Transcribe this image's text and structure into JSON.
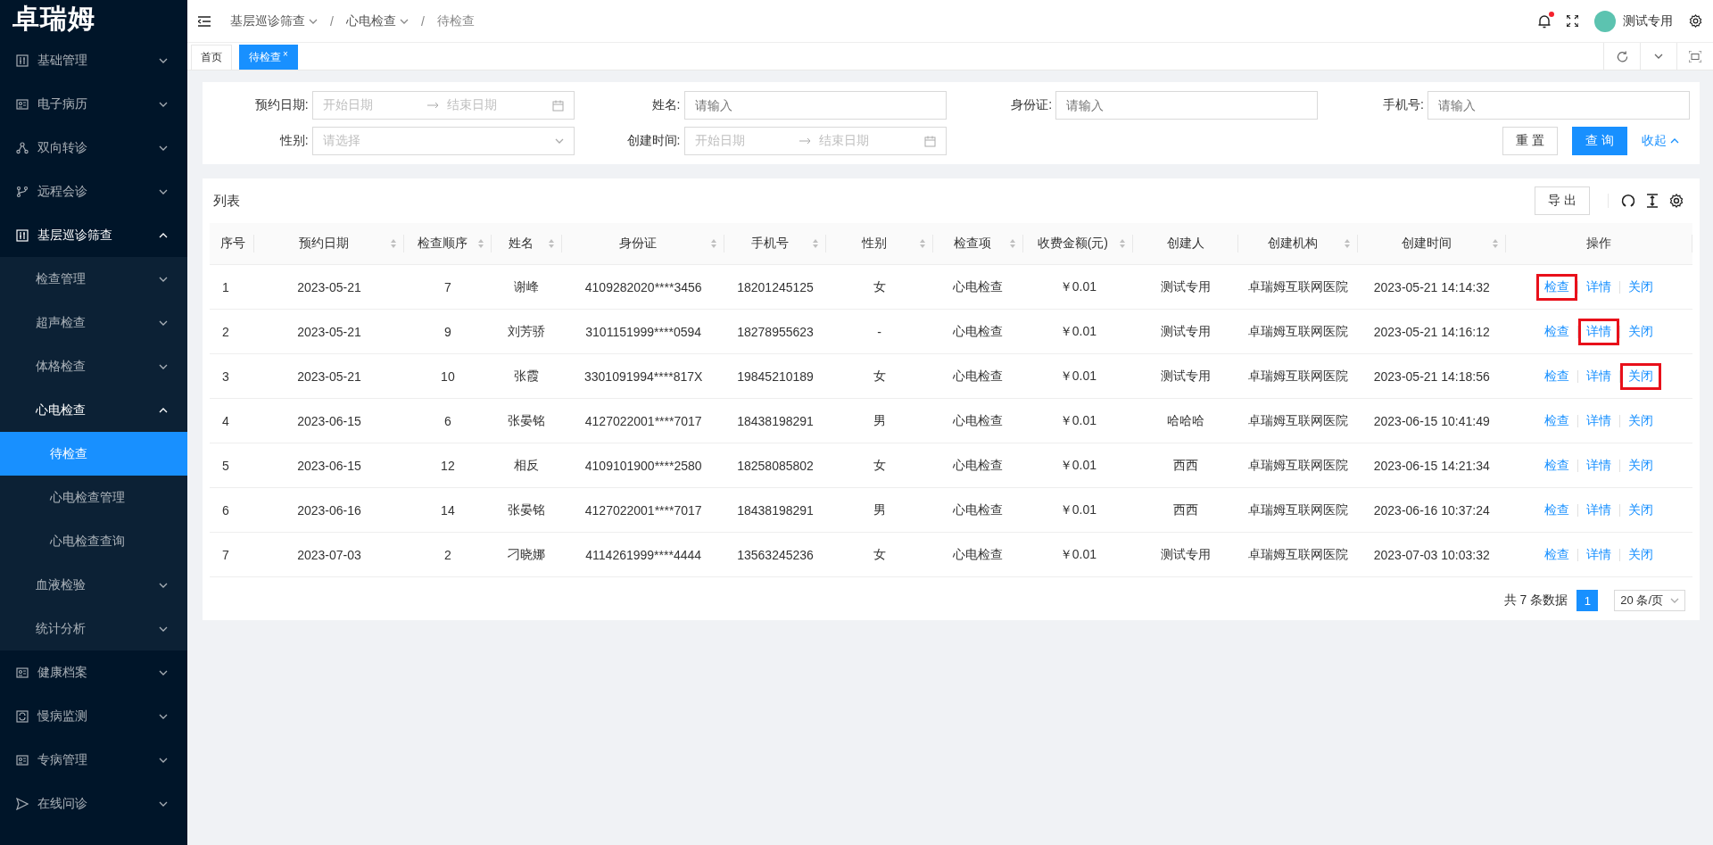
{
  "sidebar": {
    "logo": "卓瑞姆",
    "items": [
      {
        "label": "基础管理",
        "expanded": false
      },
      {
        "label": "电子病历",
        "expanded": false
      },
      {
        "label": "双向转诊",
        "expanded": false
      },
      {
        "label": "远程会诊",
        "expanded": false
      },
      {
        "label": "基层巡诊筛查",
        "expanded": true,
        "children": [
          {
            "label": "检查管理",
            "expanded": false
          },
          {
            "label": "超声检查",
            "expanded": false
          },
          {
            "label": "体格检查",
            "expanded": false
          },
          {
            "label": "心电检查",
            "expanded": true,
            "children": [
              {
                "label": "待检查",
                "selected": true
              },
              {
                "label": "心电检查管理",
                "selected": false
              },
              {
                "label": "心电检查查询",
                "selected": false
              }
            ]
          },
          {
            "label": "血液检验",
            "expanded": false
          },
          {
            "label": "统计分析",
            "expanded": false
          }
        ]
      },
      {
        "label": "健康档案",
        "expanded": false
      },
      {
        "label": "慢病监测",
        "expanded": false
      },
      {
        "label": "专病管理",
        "expanded": false
      },
      {
        "label": "在线问诊",
        "expanded": false
      }
    ]
  },
  "header": {
    "separator": "/",
    "breadcrumb": [
      {
        "label": "基层巡诊筛查",
        "dropdown": true
      },
      {
        "label": "心电检查",
        "dropdown": true
      },
      {
        "label": "待检查",
        "dropdown": false
      }
    ],
    "notification_dot": true,
    "user": "测试专用"
  },
  "tabs": [
    {
      "label": "首页",
      "selected": false
    },
    {
      "label": "待检查",
      "selected": true,
      "close": "×"
    }
  ],
  "filters": {
    "fields": [
      {
        "label": "预约日期:",
        "kind": "date-range",
        "start_placeholder": "开始日期",
        "end_placeholder": "结束日期"
      },
      {
        "label": "姓名:",
        "kind": "input",
        "placeholder": "请输入"
      },
      {
        "label": "身份证:",
        "kind": "input",
        "placeholder": "请输入"
      },
      {
        "label": "手机号:",
        "kind": "input",
        "placeholder": "请输入"
      },
      {
        "label": "性别:",
        "kind": "select",
        "placeholder": "请选择"
      },
      {
        "label": "创建时间:",
        "kind": "date-range",
        "start_placeholder": "开始日期",
        "end_placeholder": "结束日期"
      }
    ],
    "reset": "重 置",
    "query": "查 询",
    "collapse": "收起"
  },
  "table": {
    "title": "列表",
    "export": "导 出",
    "columns": [
      {
        "label": "序号",
        "sortable": false
      },
      {
        "label": "预约日期",
        "sortable": true
      },
      {
        "label": "检查顺序",
        "sortable": true
      },
      {
        "label": "姓名",
        "sortable": true
      },
      {
        "label": "身份证",
        "sortable": true
      },
      {
        "label": "手机号",
        "sortable": true
      },
      {
        "label": "性别",
        "sortable": true
      },
      {
        "label": "检查项",
        "sortable": true
      },
      {
        "label": "收费金额(元)",
        "sortable": true
      },
      {
        "label": "创建人",
        "sortable": false
      },
      {
        "label": "创建机构",
        "sortable": true
      },
      {
        "label": "创建时间",
        "sortable": true
      },
      {
        "label": "操作",
        "sortable": false
      }
    ],
    "rows": [
      {
        "cells": [
          "1",
          "2023-05-21",
          "7",
          "谢峰",
          "4109282020****3456",
          "18201245125",
          "女",
          "心电检查",
          "￥0.01",
          "测试专用",
          "卓瑞姆互联网医院",
          "2023-05-21 14:14:32"
        ],
        "actions": [
          {
            "label": "检查",
            "highlighted": true
          },
          {
            "label": "详情",
            "highlighted": false
          },
          {
            "label": "关闭",
            "highlighted": false
          }
        ]
      },
      {
        "cells": [
          "2",
          "2023-05-21",
          "9",
          "刘芳骄",
          "3101151999****0594",
          "18278955623",
          "-",
          "心电检查",
          "￥0.01",
          "测试专用",
          "卓瑞姆互联网医院",
          "2023-05-21 14:16:12"
        ],
        "actions": [
          {
            "label": "检查",
            "highlighted": false
          },
          {
            "label": "详情",
            "highlighted": true
          },
          {
            "label": "关闭",
            "highlighted": false
          }
        ]
      },
      {
        "cells": [
          "3",
          "2023-05-21",
          "10",
          "张霞",
          "3301091994****817X",
          "19845210189",
          "女",
          "心电检查",
          "￥0.01",
          "测试专用",
          "卓瑞姆互联网医院",
          "2023-05-21 14:18:56"
        ],
        "actions": [
          {
            "label": "检查",
            "highlighted": false
          },
          {
            "label": "详情",
            "highlighted": false
          },
          {
            "label": "关闭",
            "highlighted": true
          }
        ]
      },
      {
        "cells": [
          "4",
          "2023-06-15",
          "6",
          "张晏铭",
          "4127022001****7017",
          "18438198291",
          "男",
          "心电检查",
          "￥0.01",
          "哈哈哈",
          "卓瑞姆互联网医院",
          "2023-06-15 10:41:49"
        ],
        "actions": [
          {
            "label": "检查",
            "highlighted": false
          },
          {
            "label": "详情",
            "highlighted": false
          },
          {
            "label": "关闭",
            "highlighted": false
          }
        ]
      },
      {
        "cells": [
          "5",
          "2023-06-15",
          "12",
          "相反",
          "4109101900****2580",
          "18258085802",
          "女",
          "心电检查",
          "￥0.01",
          "西西",
          "卓瑞姆互联网医院",
          "2023-06-15 14:21:34"
        ],
        "actions": [
          {
            "label": "检查",
            "highlighted": false
          },
          {
            "label": "详情",
            "highlighted": false
          },
          {
            "label": "关闭",
            "highlighted": false
          }
        ]
      },
      {
        "cells": [
          "6",
          "2023-06-16",
          "14",
          "张晏铭",
          "4127022001****7017",
          "18438198291",
          "男",
          "心电检查",
          "￥0.01",
          "西西",
          "卓瑞姆互联网医院",
          "2023-06-16 10:37:24"
        ],
        "actions": [
          {
            "label": "检查",
            "highlighted": false
          },
          {
            "label": "详情",
            "highlighted": false
          },
          {
            "label": "关闭",
            "highlighted": false
          }
        ]
      },
      {
        "cells": [
          "7",
          "2023-07-03",
          "2",
          "刁晓娜",
          "4114261999****4444",
          "13563245236",
          "女",
          "心电检查",
          "￥0.01",
          "测试专用",
          "卓瑞姆互联网医院",
          "2023-07-03 10:03:32"
        ],
        "actions": [
          {
            "label": "检查",
            "highlighted": false
          },
          {
            "label": "详情",
            "highlighted": false
          },
          {
            "label": "关闭",
            "highlighted": false
          }
        ]
      }
    ],
    "pagination": {
      "total": "共 7 条数据",
      "pages": [
        {
          "label": "1",
          "selected": true
        }
      ],
      "page_size": "20 条/页"
    }
  }
}
